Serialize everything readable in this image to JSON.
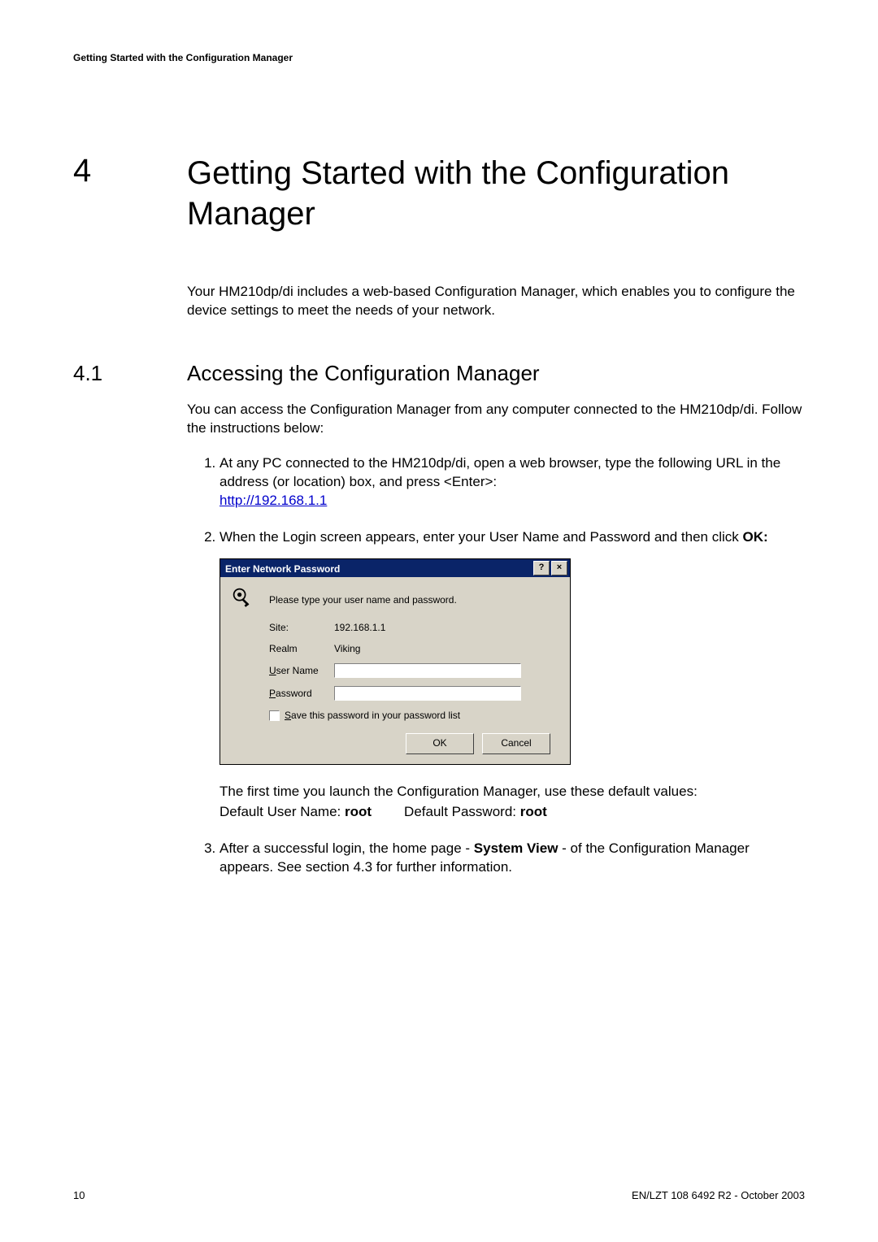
{
  "header": {
    "running": "Getting Started with the Configuration Manager"
  },
  "chapter": {
    "number": "4",
    "title": "Getting Started with the Configuration Manager"
  },
  "intro": "Your HM210dp/di includes a web-based Configuration Manager, which enables you to configure the device settings to meet the needs of your network.",
  "section": {
    "number": "4.1",
    "title": "Accessing the Configuration Manager"
  },
  "section_intro": "You can access the Configuration Manager from any computer connected to the HM210dp/di. Follow the instructions below:",
  "step1": {
    "text_before_link": "At any PC connected to the HM210dp/di, open a web browser, type the following URL in the address (or location) box, and press <Enter>:",
    "link": "http://192.168.1.1"
  },
  "step2": {
    "text_before": "When the Login screen appears, enter your User Name and Password and then click ",
    "bold": "OK:"
  },
  "dialog": {
    "title": "Enter Network Password",
    "help_btn": "?",
    "close_btn": "×",
    "instruction": "Please type your user name and password.",
    "site_label": "Site:",
    "site_value": "192.168.1.1",
    "realm_label": "Realm",
    "realm_value": "Viking",
    "username_label_u": "U",
    "username_label_rest": "ser Name",
    "password_label_u": "P",
    "password_label_rest": "assword",
    "save_u": "S",
    "save_rest": "ave this password in your password list",
    "ok": "OK",
    "cancel": "Cancel"
  },
  "after_dialog": {
    "line1": "The first time you launch the Configuration Manager, use these default values:",
    "user_prefix": "Default User Name: ",
    "user_value": "root",
    "pass_prefix": "Default Password: ",
    "pass_value": "root"
  },
  "step3": {
    "before": "After a successful login, the home page - ",
    "bold": "System View",
    "after": " - of the Configuration Manager appears. See section 4.3 for further information."
  },
  "footer": {
    "page": "10",
    "docref": "EN/LZT 108 6492 R2  -  October 2003"
  }
}
